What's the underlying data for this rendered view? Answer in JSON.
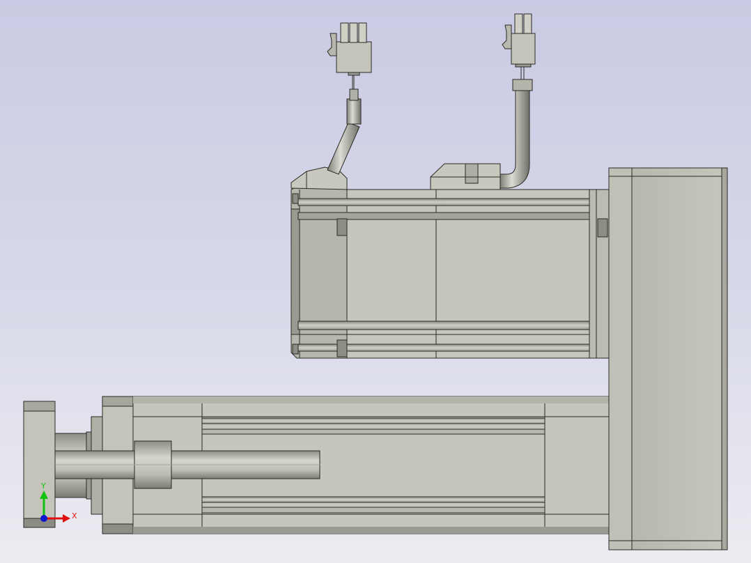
{
  "viewport": {
    "background_top": "#c9cae3",
    "background_bottom": "#ececf2"
  },
  "triad": {
    "y_label": "Y",
    "x_label": "X",
    "x_color": "#e01010",
    "y_color": "#12c012",
    "z_color": "#1018d0"
  },
  "model": {
    "body_color": "#c2c2b8",
    "edge_color": "#2a2a26",
    "connector_icon": "connector-plug-icon",
    "cable_icon": "cable-icon"
  }
}
